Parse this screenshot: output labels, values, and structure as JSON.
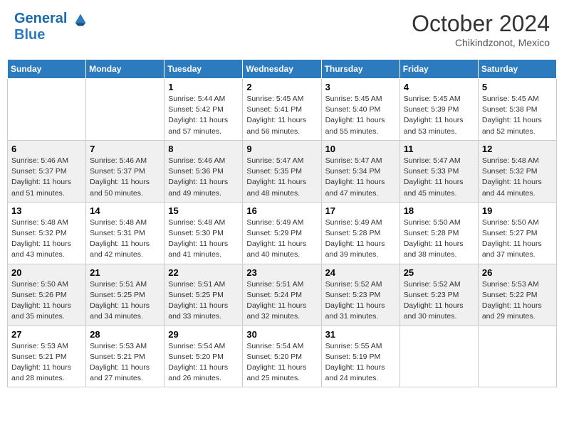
{
  "header": {
    "logo_line1": "General",
    "logo_line2": "Blue",
    "month": "October 2024",
    "location": "Chikindzonot, Mexico"
  },
  "weekdays": [
    "Sunday",
    "Monday",
    "Tuesday",
    "Wednesday",
    "Thursday",
    "Friday",
    "Saturday"
  ],
  "weeks": [
    [
      null,
      null,
      {
        "day": 1,
        "sunrise": "5:44 AM",
        "sunset": "5:42 PM",
        "daylight": "11 hours and 57 minutes."
      },
      {
        "day": 2,
        "sunrise": "5:45 AM",
        "sunset": "5:41 PM",
        "daylight": "11 hours and 56 minutes."
      },
      {
        "day": 3,
        "sunrise": "5:45 AM",
        "sunset": "5:40 PM",
        "daylight": "11 hours and 55 minutes."
      },
      {
        "day": 4,
        "sunrise": "5:45 AM",
        "sunset": "5:39 PM",
        "daylight": "11 hours and 53 minutes."
      },
      {
        "day": 5,
        "sunrise": "5:45 AM",
        "sunset": "5:38 PM",
        "daylight": "11 hours and 52 minutes."
      }
    ],
    [
      {
        "day": 6,
        "sunrise": "5:46 AM",
        "sunset": "5:37 PM",
        "daylight": "11 hours and 51 minutes."
      },
      {
        "day": 7,
        "sunrise": "5:46 AM",
        "sunset": "5:37 PM",
        "daylight": "11 hours and 50 minutes."
      },
      {
        "day": 8,
        "sunrise": "5:46 AM",
        "sunset": "5:36 PM",
        "daylight": "11 hours and 49 minutes."
      },
      {
        "day": 9,
        "sunrise": "5:47 AM",
        "sunset": "5:35 PM",
        "daylight": "11 hours and 48 minutes."
      },
      {
        "day": 10,
        "sunrise": "5:47 AM",
        "sunset": "5:34 PM",
        "daylight": "11 hours and 47 minutes."
      },
      {
        "day": 11,
        "sunrise": "5:47 AM",
        "sunset": "5:33 PM",
        "daylight": "11 hours and 45 minutes."
      },
      {
        "day": 12,
        "sunrise": "5:48 AM",
        "sunset": "5:32 PM",
        "daylight": "11 hours and 44 minutes."
      }
    ],
    [
      {
        "day": 13,
        "sunrise": "5:48 AM",
        "sunset": "5:32 PM",
        "daylight": "11 hours and 43 minutes."
      },
      {
        "day": 14,
        "sunrise": "5:48 AM",
        "sunset": "5:31 PM",
        "daylight": "11 hours and 42 minutes."
      },
      {
        "day": 15,
        "sunrise": "5:48 AM",
        "sunset": "5:30 PM",
        "daylight": "11 hours and 41 minutes."
      },
      {
        "day": 16,
        "sunrise": "5:49 AM",
        "sunset": "5:29 PM",
        "daylight": "11 hours and 40 minutes."
      },
      {
        "day": 17,
        "sunrise": "5:49 AM",
        "sunset": "5:28 PM",
        "daylight": "11 hours and 39 minutes."
      },
      {
        "day": 18,
        "sunrise": "5:50 AM",
        "sunset": "5:28 PM",
        "daylight": "11 hours and 38 minutes."
      },
      {
        "day": 19,
        "sunrise": "5:50 AM",
        "sunset": "5:27 PM",
        "daylight": "11 hours and 37 minutes."
      }
    ],
    [
      {
        "day": 20,
        "sunrise": "5:50 AM",
        "sunset": "5:26 PM",
        "daylight": "11 hours and 35 minutes."
      },
      {
        "day": 21,
        "sunrise": "5:51 AM",
        "sunset": "5:25 PM",
        "daylight": "11 hours and 34 minutes."
      },
      {
        "day": 22,
        "sunrise": "5:51 AM",
        "sunset": "5:25 PM",
        "daylight": "11 hours and 33 minutes."
      },
      {
        "day": 23,
        "sunrise": "5:51 AM",
        "sunset": "5:24 PM",
        "daylight": "11 hours and 32 minutes."
      },
      {
        "day": 24,
        "sunrise": "5:52 AM",
        "sunset": "5:23 PM",
        "daylight": "11 hours and 31 minutes."
      },
      {
        "day": 25,
        "sunrise": "5:52 AM",
        "sunset": "5:23 PM",
        "daylight": "11 hours and 30 minutes."
      },
      {
        "day": 26,
        "sunrise": "5:53 AM",
        "sunset": "5:22 PM",
        "daylight": "11 hours and 29 minutes."
      }
    ],
    [
      {
        "day": 27,
        "sunrise": "5:53 AM",
        "sunset": "5:21 PM",
        "daylight": "11 hours and 28 minutes."
      },
      {
        "day": 28,
        "sunrise": "5:53 AM",
        "sunset": "5:21 PM",
        "daylight": "11 hours and 27 minutes."
      },
      {
        "day": 29,
        "sunrise": "5:54 AM",
        "sunset": "5:20 PM",
        "daylight": "11 hours and 26 minutes."
      },
      {
        "day": 30,
        "sunrise": "5:54 AM",
        "sunset": "5:20 PM",
        "daylight": "11 hours and 25 minutes."
      },
      {
        "day": 31,
        "sunrise": "5:55 AM",
        "sunset": "5:19 PM",
        "daylight": "11 hours and 24 minutes."
      },
      null,
      null
    ]
  ]
}
